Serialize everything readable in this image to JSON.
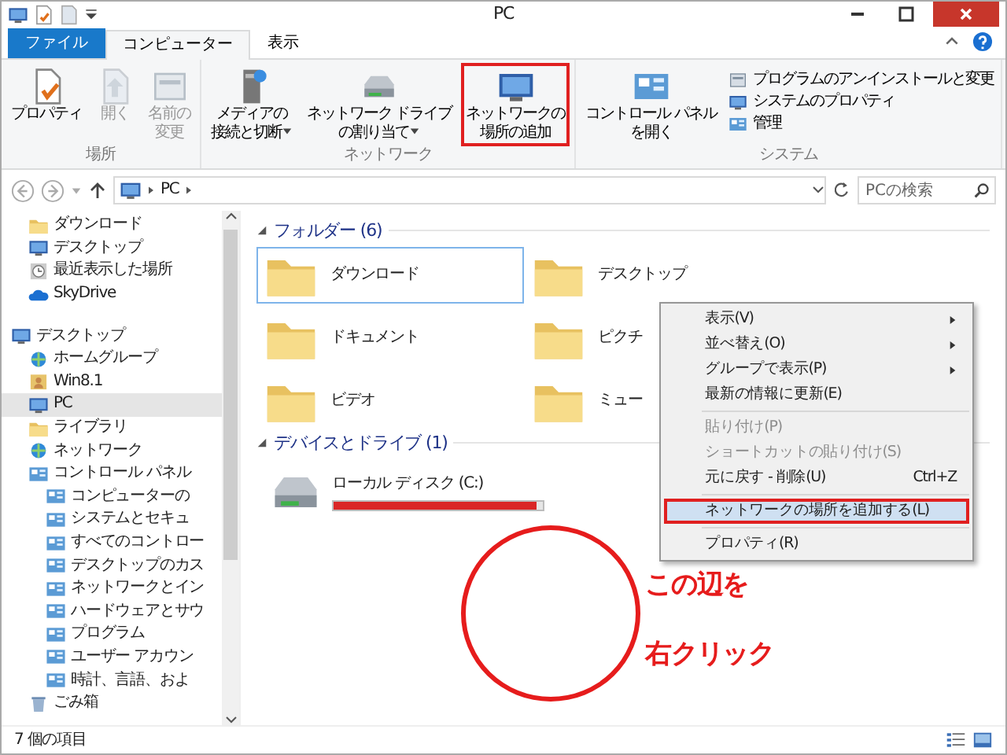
{
  "window": {
    "title": "PC"
  },
  "ribbon": {
    "tabs": [
      {
        "label": "ファイル",
        "kind": "file",
        "selected": false
      },
      {
        "label": "コンピューター",
        "kind": "tab",
        "selected": true
      },
      {
        "label": "表示",
        "kind": "tab",
        "selected": false
      }
    ],
    "groups": [
      {
        "label": "場所",
        "buttons": [
          {
            "lines": [
              "プロパティ"
            ],
            "disabled": false,
            "dropdown": false,
            "annotated": false
          },
          {
            "lines": [
              "開く"
            ],
            "disabled": true,
            "dropdown": false,
            "annotated": false
          },
          {
            "lines": [
              "名前の",
              "変更"
            ],
            "disabled": true,
            "dropdown": false,
            "annotated": false
          }
        ]
      },
      {
        "label": "ネットワーク",
        "buttons": [
          {
            "lines": [
              "メディアの",
              "接続と切断"
            ],
            "disabled": false,
            "dropdown": true,
            "annotated": false
          },
          {
            "lines": [
              "ネットワーク ドライブ",
              "の割り当て"
            ],
            "disabled": false,
            "dropdown": true,
            "annotated": false
          },
          {
            "lines": [
              "ネットワークの",
              "場所の追加"
            ],
            "disabled": false,
            "dropdown": false,
            "annotated": true
          }
        ]
      },
      {
        "label": "システム",
        "buttons": [
          {
            "lines": [
              "コントロール パネル",
              "を開く"
            ],
            "disabled": false,
            "dropdown": false,
            "annotated": false
          }
        ],
        "small_buttons": [
          "プログラムのアンインストールと変更",
          "システムのプロパティ",
          "管理"
        ]
      }
    ]
  },
  "address": {
    "path": [
      "PC"
    ]
  },
  "search": {
    "placeholder": "PCの検索"
  },
  "nav": {
    "favorites": [
      {
        "label": "ダウンロード",
        "selected": false
      },
      {
        "label": "デスクトップ",
        "selected": false
      },
      {
        "label": "最近表示した場所",
        "selected": false
      },
      {
        "label": "SkyDrive",
        "selected": false
      }
    ],
    "tree": [
      {
        "label": "デスクトップ",
        "selected": false,
        "children": [
          {
            "label": "ホームグループ",
            "selected": false
          },
          {
            "label": "Win8.1",
            "selected": false
          },
          {
            "label": "PC",
            "selected": true
          },
          {
            "label": "ライブラリ",
            "selected": false
          },
          {
            "label": "ネットワーク",
            "selected": false
          },
          {
            "label": "コントロール パネル",
            "selected": false,
            "children": [
              {
                "label": "コンピューターの",
                "selected": false
              },
              {
                "label": "システムとセキュ",
                "selected": false
              },
              {
                "label": "すべてのコントロー",
                "selected": false
              },
              {
                "label": "デスクトップのカス",
                "selected": false
              },
              {
                "label": "ネットワークとイン",
                "selected": false
              },
              {
                "label": "ハードウェアとサウ",
                "selected": false
              },
              {
                "label": "プログラム",
                "selected": false
              },
              {
                "label": "ユーザー アカウン",
                "selected": false
              },
              {
                "label": "時計、言語、およ",
                "selected": false
              }
            ]
          },
          {
            "label": "ごみ箱",
            "selected": false
          }
        ]
      }
    ]
  },
  "content": {
    "groups": [
      {
        "title": "フォルダー (6)",
        "kind": "folders",
        "items": [
          {
            "label": "ダウンロード",
            "selected": true
          },
          {
            "label": "デスクトップ",
            "selected": false
          },
          {
            "label": "ドキュメント",
            "selected": false
          },
          {
            "label": "ピクチ",
            "selected": false
          },
          {
            "label": "ビデオ",
            "selected": false
          },
          {
            "label": "ミュー",
            "selected": false
          }
        ]
      },
      {
        "title": "デバイスとドライブ (1)",
        "kind": "drives",
        "items": [
          {
            "label": "ローカル ディスク (C:)",
            "selected": false,
            "level": 0.97
          }
        ]
      }
    ]
  },
  "context_menu": {
    "items": [
      {
        "kind": "item",
        "label": "表示(V)",
        "submenu": true,
        "disabled": false,
        "highlighted": false,
        "annotated": false
      },
      {
        "kind": "item",
        "label": "並べ替え(O)",
        "submenu": true,
        "disabled": false,
        "highlighted": false,
        "annotated": false
      },
      {
        "kind": "item",
        "label": "グループで表示(P)",
        "submenu": true,
        "disabled": false,
        "highlighted": false,
        "annotated": false
      },
      {
        "kind": "item",
        "label": "最新の情報に更新(E)",
        "submenu": false,
        "disabled": false,
        "highlighted": false,
        "annotated": false
      },
      {
        "kind": "separator"
      },
      {
        "kind": "item",
        "label": "貼り付け(P)",
        "submenu": false,
        "disabled": true,
        "highlighted": false,
        "annotated": false
      },
      {
        "kind": "item",
        "label": "ショートカットの貼り付け(S)",
        "submenu": false,
        "disabled": true,
        "highlighted": false,
        "annotated": false
      },
      {
        "kind": "item",
        "label": "元に戻す - 削除(U)",
        "shortcut": "Ctrl+Z",
        "submenu": false,
        "disabled": false,
        "highlighted": false,
        "annotated": false
      },
      {
        "kind": "separator"
      },
      {
        "kind": "item",
        "label": "ネットワークの場所を追加する(L)",
        "submenu": false,
        "disabled": false,
        "highlighted": true,
        "annotated": true
      },
      {
        "kind": "separator"
      },
      {
        "kind": "item",
        "label": "プロパティ(R)",
        "submenu": false,
        "disabled": false,
        "highlighted": false,
        "annotated": false
      }
    ]
  },
  "annotation": {
    "lines": [
      "この辺を",
      "右クリック"
    ]
  },
  "status_bar": {
    "text": "7 個の項目"
  }
}
